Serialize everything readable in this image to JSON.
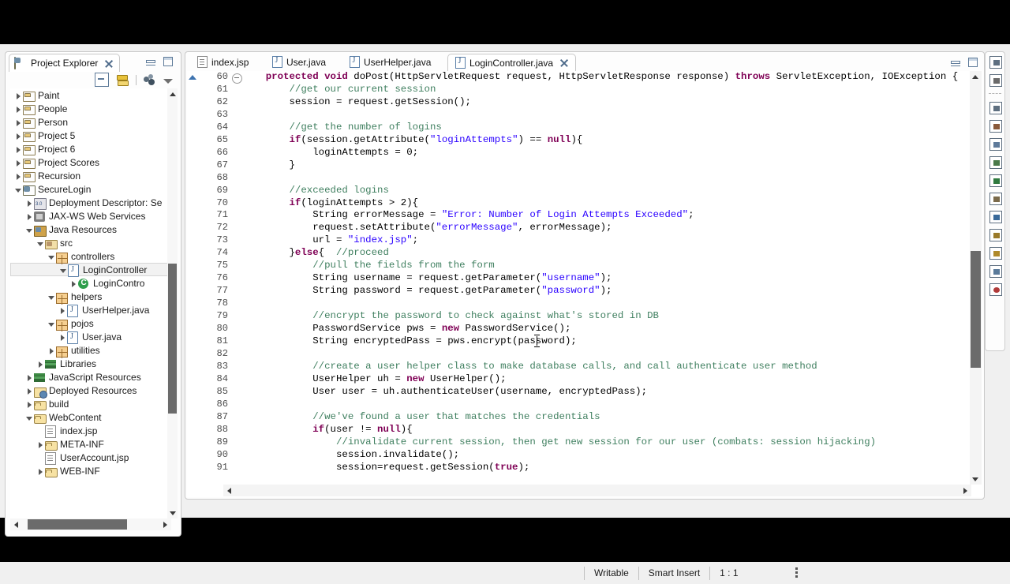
{
  "explorer": {
    "title": "Project Explorer",
    "toolbar": [
      "collapse-all-icon",
      "link-with-editor-icon",
      "focus-icon",
      "view-menu-icon"
    ],
    "tree": [
      {
        "label": "Paint",
        "depth": 0,
        "arrow": "closed",
        "icon": "project-folder-icon"
      },
      {
        "label": "People",
        "depth": 0,
        "arrow": "closed",
        "icon": "project-folder-icon"
      },
      {
        "label": "Person",
        "depth": 0,
        "arrow": "closed",
        "icon": "project-folder-icon"
      },
      {
        "label": "Project 5",
        "depth": 0,
        "arrow": "closed",
        "icon": "project-folder-icon"
      },
      {
        "label": "Project 6",
        "depth": 0,
        "arrow": "closed",
        "icon": "project-folder-icon"
      },
      {
        "label": "Project Scores",
        "depth": 0,
        "arrow": "closed",
        "icon": "project-folder-icon"
      },
      {
        "label": "Recursion",
        "depth": 0,
        "arrow": "closed",
        "icon": "project-folder-icon"
      },
      {
        "label": "SecureLogin",
        "depth": 0,
        "arrow": "open",
        "icon": "web-project-icon"
      },
      {
        "label": "Deployment Descriptor: Se",
        "depth": 1,
        "arrow": "closed",
        "icon": "deployment-descriptor-icon"
      },
      {
        "label": "JAX-WS Web Services",
        "depth": 1,
        "arrow": "closed",
        "icon": "web-services-icon"
      },
      {
        "label": "Java Resources",
        "depth": 1,
        "arrow": "open",
        "icon": "java-resources-icon"
      },
      {
        "label": "src",
        "depth": 2,
        "arrow": "open",
        "icon": "source-folder-icon"
      },
      {
        "label": "controllers",
        "depth": 3,
        "arrow": "open",
        "icon": "package-icon"
      },
      {
        "label": "LoginController",
        "depth": 4,
        "arrow": "open",
        "icon": "java-file-icon",
        "selected": true
      },
      {
        "label": "LoginContro",
        "depth": 5,
        "arrow": "closed",
        "icon": "java-class-icon"
      },
      {
        "label": "helpers",
        "depth": 3,
        "arrow": "open",
        "icon": "package-icon"
      },
      {
        "label": "UserHelper.java",
        "depth": 4,
        "arrow": "closed",
        "icon": "java-file-icon"
      },
      {
        "label": "pojos",
        "depth": 3,
        "arrow": "open",
        "icon": "package-icon"
      },
      {
        "label": "User.java",
        "depth": 4,
        "arrow": "closed",
        "icon": "java-file-icon"
      },
      {
        "label": "utilities",
        "depth": 3,
        "arrow": "closed",
        "icon": "package-icon"
      },
      {
        "label": "Libraries",
        "depth": 2,
        "arrow": "closed",
        "icon": "library-icon"
      },
      {
        "label": "JavaScript Resources",
        "depth": 1,
        "arrow": "closed",
        "icon": "library-icon"
      },
      {
        "label": "Deployed Resources",
        "depth": 1,
        "arrow": "closed",
        "icon": "deployed-resources-icon"
      },
      {
        "label": "build",
        "depth": 1,
        "arrow": "closed",
        "icon": "folder-icon"
      },
      {
        "label": "WebContent",
        "depth": 1,
        "arrow": "open",
        "icon": "folder-icon"
      },
      {
        "label": "index.jsp",
        "depth": 2,
        "arrow": "none",
        "icon": "jsp-file-icon"
      },
      {
        "label": "META-INF",
        "depth": 2,
        "arrow": "closed",
        "icon": "folder-icon"
      },
      {
        "label": "UserAccount.jsp",
        "depth": 2,
        "arrow": "none",
        "icon": "jsp-file-icon"
      },
      {
        "label": "WEB-INF",
        "depth": 2,
        "arrow": "closed",
        "icon": "folder-icon"
      }
    ]
  },
  "editor": {
    "tabs": [
      {
        "label": "index.jsp",
        "icon": "jsp-file-icon",
        "active": false,
        "closable": false
      },
      {
        "label": "User.java",
        "icon": "java-file-icon",
        "active": false,
        "closable": false
      },
      {
        "label": "UserHelper.java",
        "icon": "java-file-icon",
        "active": false,
        "closable": false
      },
      {
        "label": "LoginController.java",
        "icon": "java-file-icon",
        "active": true,
        "closable": true
      }
    ],
    "first_line_number": 60,
    "lines": [
      {
        "n": 60,
        "fold": true,
        "html": "    <span class=\"kw\">protected</span> <span class=\"kw\">void</span> doPost(HttpServletRequest request, HttpServletResponse response) <span class=\"kw\">throws</span> ServletException, IOException {"
      },
      {
        "n": 61,
        "fold": false,
        "html": "        <span class=\"cmt\">//get our current session</span>"
      },
      {
        "n": 62,
        "fold": false,
        "html": "        session = request.getSession();"
      },
      {
        "n": 63,
        "fold": false,
        "html": ""
      },
      {
        "n": 64,
        "fold": false,
        "html": "        <span class=\"cmt\">//get the number of logins</span>"
      },
      {
        "n": 65,
        "fold": false,
        "html": "        <span class=\"kw\">if</span>(session.getAttribute(<span class=\"str\">\"loginAttempts\"</span>) == <span class=\"kw\">null</span>){"
      },
      {
        "n": 66,
        "fold": false,
        "html": "            loginAttempts = 0;"
      },
      {
        "n": 67,
        "fold": false,
        "html": "        }"
      },
      {
        "n": 68,
        "fold": false,
        "html": ""
      },
      {
        "n": 69,
        "fold": false,
        "html": "        <span class=\"cmt\">//exceeded logins</span>"
      },
      {
        "n": 70,
        "fold": false,
        "html": "        <span class=\"kw\">if</span>(loginAttempts > 2){"
      },
      {
        "n": 71,
        "fold": false,
        "html": "            String errorMessage = <span class=\"str\">\"Error: Number of Login Attempts Exceeded\"</span>;"
      },
      {
        "n": 72,
        "fold": false,
        "html": "            request.setAttribute(<span class=\"str\">\"errorMessage\"</span>, errorMessage);"
      },
      {
        "n": 73,
        "fold": false,
        "html": "            url = <span class=\"str\">\"index.jsp\"</span>;"
      },
      {
        "n": 74,
        "fold": false,
        "html": "        }<span class=\"kw\">else</span>{  <span class=\"cmt\">//proceed</span>"
      },
      {
        "n": 75,
        "fold": false,
        "html": "            <span class=\"cmt\">//pull the fields from the form</span>"
      },
      {
        "n": 76,
        "fold": false,
        "html": "            String username = request.getParameter(<span class=\"str\">\"username\"</span>);"
      },
      {
        "n": 77,
        "fold": false,
        "html": "            String password = request.getParameter(<span class=\"str\">\"password\"</span>);"
      },
      {
        "n": 78,
        "fold": false,
        "html": ""
      },
      {
        "n": 79,
        "fold": false,
        "html": "            <span class=\"cmt\">//encrypt the password to check against what's stored in DB</span>"
      },
      {
        "n": 80,
        "fold": false,
        "html": "            PasswordService pws = <span class=\"kw\">new</span> PasswordService();"
      },
      {
        "n": 81,
        "fold": false,
        "html": "            String encryptedPass = pws.encrypt(password);"
      },
      {
        "n": 82,
        "fold": false,
        "html": ""
      },
      {
        "n": 83,
        "fold": false,
        "html": "            <span class=\"cmt\">//create a user helper class to make database calls, and call authenticate user method</span>"
      },
      {
        "n": 84,
        "fold": false,
        "html": "            UserHelper uh = <span class=\"kw\">new</span> UserHelper();"
      },
      {
        "n": 85,
        "fold": false,
        "html": "            User user = uh.authenticateUser(username, encryptedPass);"
      },
      {
        "n": 86,
        "fold": false,
        "html": ""
      },
      {
        "n": 87,
        "fold": false,
        "html": "            <span class=\"cmt\">//we've found a user that matches the credentials</span>"
      },
      {
        "n": 88,
        "fold": false,
        "html": "            <span class=\"kw\">if</span>(user != <span class=\"kw\">null</span>){"
      },
      {
        "n": 89,
        "fold": false,
        "html": "                <span class=\"cmt\">//invalidate current session, then get new session for our user (combats: session hijacking)</span>"
      },
      {
        "n": 90,
        "fold": false,
        "html": "                session.invalidate();"
      },
      {
        "n": 91,
        "fold": false,
        "html": "                session=request.getSession(<span class=\"kw\">true</span>);"
      }
    ]
  },
  "rightbar": {
    "icons": [
      "outline-view-icon",
      "task-list-icon",
      "separator",
      "window-icon",
      "palette-icon",
      "properties-table-icon",
      "equalizer-icon",
      "servers-icon",
      "snippets-icon",
      "console-icon",
      "debug-icon",
      "package-explorer-icon",
      "sync-icon",
      "problems-icon"
    ]
  },
  "statusbar": {
    "writable": "Writable",
    "insert_mode": "Smart Insert",
    "cursor_position": "1 : 1"
  },
  "colors": {
    "keyword": "#7f0055",
    "string": "#2a00ff",
    "comment": "#3f7f5f",
    "chrome": "#f0f0f0",
    "editor_bg": "#ffffff"
  }
}
